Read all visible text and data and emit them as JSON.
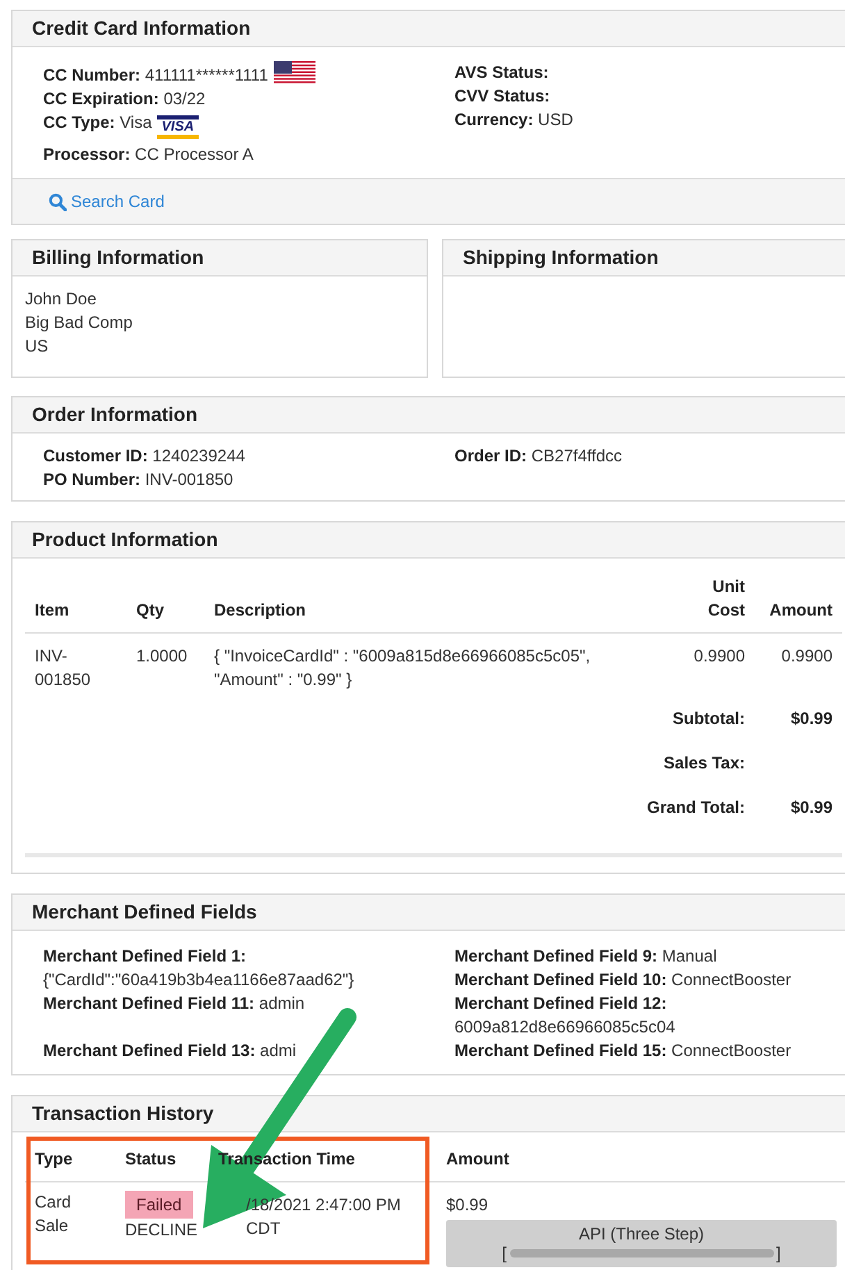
{
  "credit_card": {
    "title": "Credit Card Information",
    "left": [
      {
        "label": "CC Number:",
        "value": "411111******1111",
        "kind": "flag"
      },
      {
        "label": "CC Expiration:",
        "value": "03/22",
        "kind": "text"
      },
      {
        "label": "CC Type:",
        "value": "Visa",
        "kind": "card",
        "logo": "VISA"
      },
      {
        "label": "Processor:",
        "value": "CC Processor A",
        "kind": "text"
      }
    ],
    "right": [
      {
        "label": "AVS Status:"
      },
      {
        "label": "CVV Status:"
      },
      {
        "label": "Currency:",
        "value": "USD"
      }
    ],
    "link": "Search Card"
  },
  "billing": {
    "title": "Billing Information",
    "lines": [
      "John Doe",
      "Big Bad Comp",
      "US"
    ]
  },
  "shipping": {
    "title": "Shipping Information"
  },
  "order": {
    "title": "Order Information",
    "left": [
      {
        "label": "Customer ID:",
        "value": "1240239244"
      },
      {
        "label": "PO Number:",
        "value": "INV-001850"
      }
    ],
    "right": [
      {
        "label": "Order ID:",
        "value": "CB27f4ffdcc"
      }
    ]
  },
  "product": {
    "title": "Product Information",
    "columns": [
      "Item",
      "Qty",
      "Description",
      "Unit Cost",
      "Amount"
    ],
    "rows": [
      {
        "item": "INV-001850",
        "qty": "1.0000",
        "description": "{ \"InvoiceCardId\" : \"6009a815d8e66966085c5c05\", \"Amount\" : \"0.99\" }",
        "unit_cost": "0.9900",
        "amount": "0.9900"
      }
    ],
    "totals": [
      {
        "label": "Subtotal:",
        "value": "$0.99"
      },
      {
        "label": "Sales Tax:"
      },
      {
        "label": "Grand Total:",
        "value": "$0.99"
      }
    ]
  },
  "merchant_fields": {
    "title": "Merchant Defined Fields",
    "left": [
      {
        "label": "Merchant Defined Field 1:",
        "value": "{\"CardId\":\"60a419b3b4ea1166e87aad62\"}"
      },
      {
        "label": "Merchant Defined Field 11:",
        "value": "admin"
      },
      {
        "label": "Merchant Defined Field 13:",
        "value": "admi"
      }
    ],
    "right": [
      {
        "label": "Merchant Defined Field 9:",
        "value": "Manual"
      },
      {
        "label": "Merchant Defined Field 10:",
        "value": "ConnectBooster"
      },
      {
        "label": "Merchant Defined Field 12:",
        "value": "6009a812d8e66966085c5c04"
      },
      {
        "label": "Merchant Defined Field 15:",
        "value": "ConnectBooster"
      }
    ]
  },
  "transaction_history": {
    "title": "Transaction History",
    "columns": [
      "Type",
      "Status",
      "Transaction Time",
      "Amount"
    ],
    "rows": [
      {
        "type": "Card Sale",
        "status": "Failed",
        "kind": "failed",
        "response": "DECLINE",
        "time": "/18/2021 2:47:00 PM CDT",
        "amount": "$0.99",
        "button": "API (Three Step)",
        "bracket_open": "[",
        "bracket_close": "]"
      }
    ]
  }
}
